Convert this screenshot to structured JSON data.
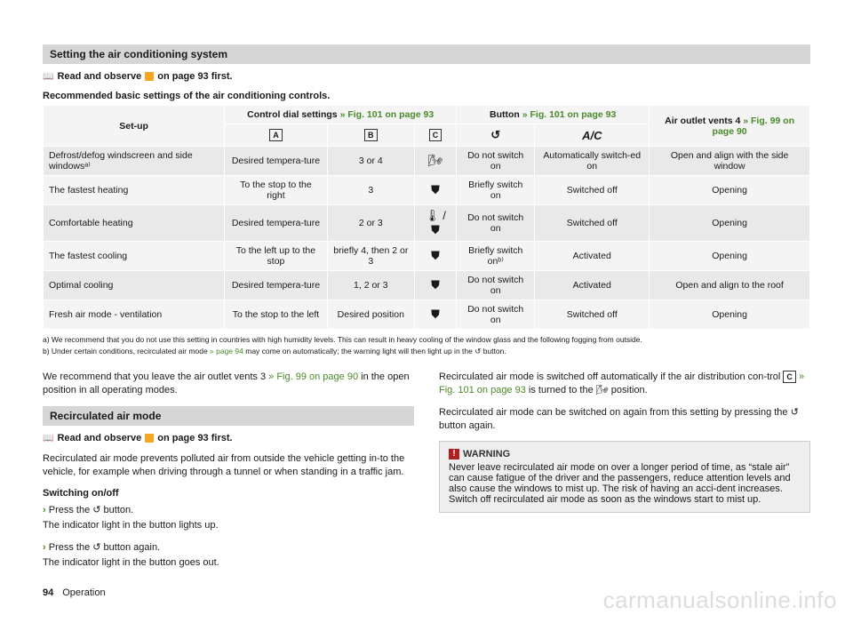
{
  "section1_title": "Setting the air conditioning system",
  "read_observe_full": "Read and observe   on page 93 first.",
  "read_observe_prefix": "Read and observe",
  "read_observe_suffix": "on page 93 first.",
  "recommended_caption": "Recommended basic settings of the air conditioning controls.",
  "table": {
    "setup_label": "Set-up",
    "control_dial_label_a": "Control dial settings ",
    "control_dial_label_b": "» Fig. 101 on page 93",
    "button_label_a": "Button ",
    "button_label_b": "» Fig. 101 on page 93",
    "vents_label_a": "Air outlet vents 4 ",
    "vents_label_b": "» Fig. 99 on page 90",
    "letters": {
      "A": "A",
      "B": "B",
      "C": "C"
    },
    "recirc_symbol": "↺",
    "ac_symbol": "A/C",
    "rows": [
      {
        "setup": "Defrost/defog windscreen and side windowsᵃ⁾",
        "a": "Desired tempera-ture",
        "b": "3 or 4",
        "c": "🌬",
        "recirc": "Do not switch on",
        "ac": "Automatically switch-ed on",
        "vents": "Open and align with the side window"
      },
      {
        "setup": "The fastest heating",
        "a": "To the stop to the right",
        "b": "3",
        "c": "⛊",
        "recirc": "Briefly switch on",
        "ac": "Switched off",
        "vents": "Opening"
      },
      {
        "setup": "Comfortable heating",
        "a": "Desired tempera-ture",
        "b": "2 or 3",
        "c": "🌡 / ⛊",
        "recirc": "Do not switch on",
        "ac": "Switched off",
        "vents": "Opening"
      },
      {
        "setup": "The fastest cooling",
        "a": "To the left up to the stop",
        "b": "briefly 4, then 2 or 3",
        "c": "⛊",
        "recirc": "Briefly switch onᵇ⁾",
        "ac": "Activated",
        "vents": "Opening"
      },
      {
        "setup": "Optimal cooling",
        "a": "Desired tempera-ture",
        "b": "1, 2 or 3",
        "c": "⛊",
        "recirc": "Do not switch on",
        "ac": "Activated",
        "vents": "Open and align to the roof"
      },
      {
        "setup": "Fresh air mode - ventilation",
        "a": "To the stop to the left",
        "b": "Desired position",
        "c": "⛊",
        "recirc": "Do not switch on",
        "ac": "Switched off",
        "vents": "Opening"
      }
    ]
  },
  "footnote_a": "a)  We recommend that you do not use this setting in countries with high humidity levels. This can result in heavy cooling of the window glass and the following fogging from outside.",
  "footnote_b_pre": "b)  Under certain conditions, recirculated air mode ",
  "footnote_b_link": "» page 94",
  "footnote_b_post": " may come on automatically; the warning light will then light up in the ↺ button.",
  "col_left": {
    "rec_text_a": "We recommend that you leave the air outlet vents 3 ",
    "rec_text_link": "» Fig. 99 on page 90",
    "rec_text_b": " in the open position in all operating modes.",
    "section2_title": "Recirculated air mode",
    "recirc_intro": "Recirculated air mode prevents polluted air from outside the vehicle getting in-to the vehicle, for example when driving through a tunnel or when standing in a traffic jam.",
    "switch_heading": "Switching on/off",
    "step1": "Press the ↺ button.",
    "step1_result": "The indicator light in the button lights up.",
    "step2": "Press the ↺ button again.",
    "step2_result": "The indicator light in the button goes out."
  },
  "col_right": {
    "para1_a": "Recirculated air mode is switched off automatically if the air distribution con-trol ",
    "para1_letter": "C",
    "para1_link": " » Fig. 101 on page 93",
    "para1_b": " is turned to the 🌬 position.",
    "para2": "Recirculated air mode can be switched on again from this setting by pressing the ↺ button again.",
    "warning_label": "WARNING",
    "warning_text": "Never leave recirculated air mode on over a longer period of time, as “stale air” can cause fatigue of the driver and the passengers, reduce attention levels and also cause the windows to mist up. The risk of having an acci-dent increases. Switch off recirculated air mode as soon as the windows start to mist up."
  },
  "footer": {
    "page": "94",
    "chapter": "Operation"
  },
  "watermark": "carmanualsonline.info"
}
